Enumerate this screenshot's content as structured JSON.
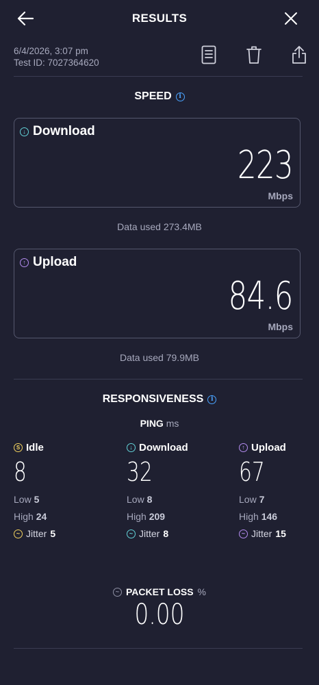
{
  "header": {
    "title": "RESULTS"
  },
  "meta": {
    "datetime": "6/4/2026, 3:07 pm",
    "test_id": "Test ID: 7027364620"
  },
  "speed": {
    "title": "SPEED",
    "download": {
      "label": "Download",
      "value": "223",
      "unit": "Mbps",
      "data_used": "Data used 273.4MB"
    },
    "upload": {
      "label": "Upload",
      "value": "84.6",
      "unit": "Mbps",
      "data_used": "Data used 79.9MB"
    }
  },
  "responsiveness": {
    "title": "RESPONSIVENESS",
    "ping_label": "PING",
    "ping_unit": "ms",
    "columns": [
      {
        "label": "Idle",
        "value": "8",
        "low_label": "Low",
        "low": "5",
        "high_label": "High",
        "high": "24",
        "jitter_label": "Jitter",
        "jitter": "5"
      },
      {
        "label": "Download",
        "value": "32",
        "low_label": "Low",
        "low": "8",
        "high_label": "High",
        "high": "209",
        "jitter_label": "Jitter",
        "jitter": "8"
      },
      {
        "label": "Upload",
        "value": "67",
        "low_label": "Low",
        "low": "7",
        "high_label": "High",
        "high": "146",
        "jitter_label": "Jitter",
        "jitter": "15"
      }
    ]
  },
  "packet_loss": {
    "label": "PACKET LOSS",
    "unit": "%",
    "value": "0.00"
  },
  "colors": {
    "background": "#1f2031",
    "idle": "#f4d35e",
    "download": "#63d3d9",
    "upload": "#b48cf0",
    "info": "#4aa3ff"
  }
}
